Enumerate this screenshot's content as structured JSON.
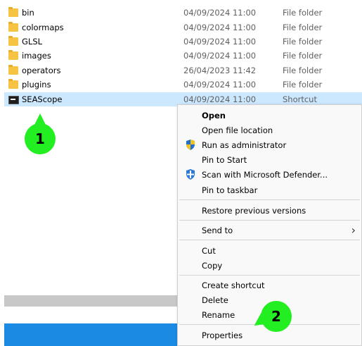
{
  "files": [
    {
      "name": "bin",
      "date": "04/09/2024 11:00",
      "type": "File folder",
      "icon": "folder-icon"
    },
    {
      "name": "colormaps",
      "date": "04/09/2024 11:00",
      "type": "File folder",
      "icon": "folder-icon"
    },
    {
      "name": "GLSL",
      "date": "04/09/2024 11:00",
      "type": "File folder",
      "icon": "folder-icon"
    },
    {
      "name": "images",
      "date": "04/09/2024 11:00",
      "type": "File folder",
      "icon": "folder-icon"
    },
    {
      "name": "operators",
      "date": "26/04/2023 11:42",
      "type": "File folder",
      "icon": "folder-icon"
    },
    {
      "name": "plugins",
      "date": "04/09/2024 11:00",
      "type": "File folder",
      "icon": "folder-icon"
    },
    {
      "name": "SEAScope",
      "date": "04/09/2024 11:00",
      "type": "Shortcut",
      "icon": "shortcut-icon"
    }
  ],
  "context_menu": {
    "open": "Open",
    "open_file_location": "Open file location",
    "run_as_admin": "Run as administrator",
    "pin_to_start": "Pin to Start",
    "scan_defender": "Scan with Microsoft Defender...",
    "pin_to_taskbar": "Pin to taskbar",
    "restore_previous": "Restore previous versions",
    "send_to": "Send to",
    "cut": "Cut",
    "copy": "Copy",
    "create_shortcut": "Create shortcut",
    "delete": "Delete",
    "rename": "Rename",
    "properties": "Properties"
  },
  "annotations": {
    "step1": "1",
    "step2": "2"
  },
  "colors": {
    "selection": "#cce8ff",
    "badge": "#22ee22",
    "taskbar": "#1a8ae3"
  }
}
